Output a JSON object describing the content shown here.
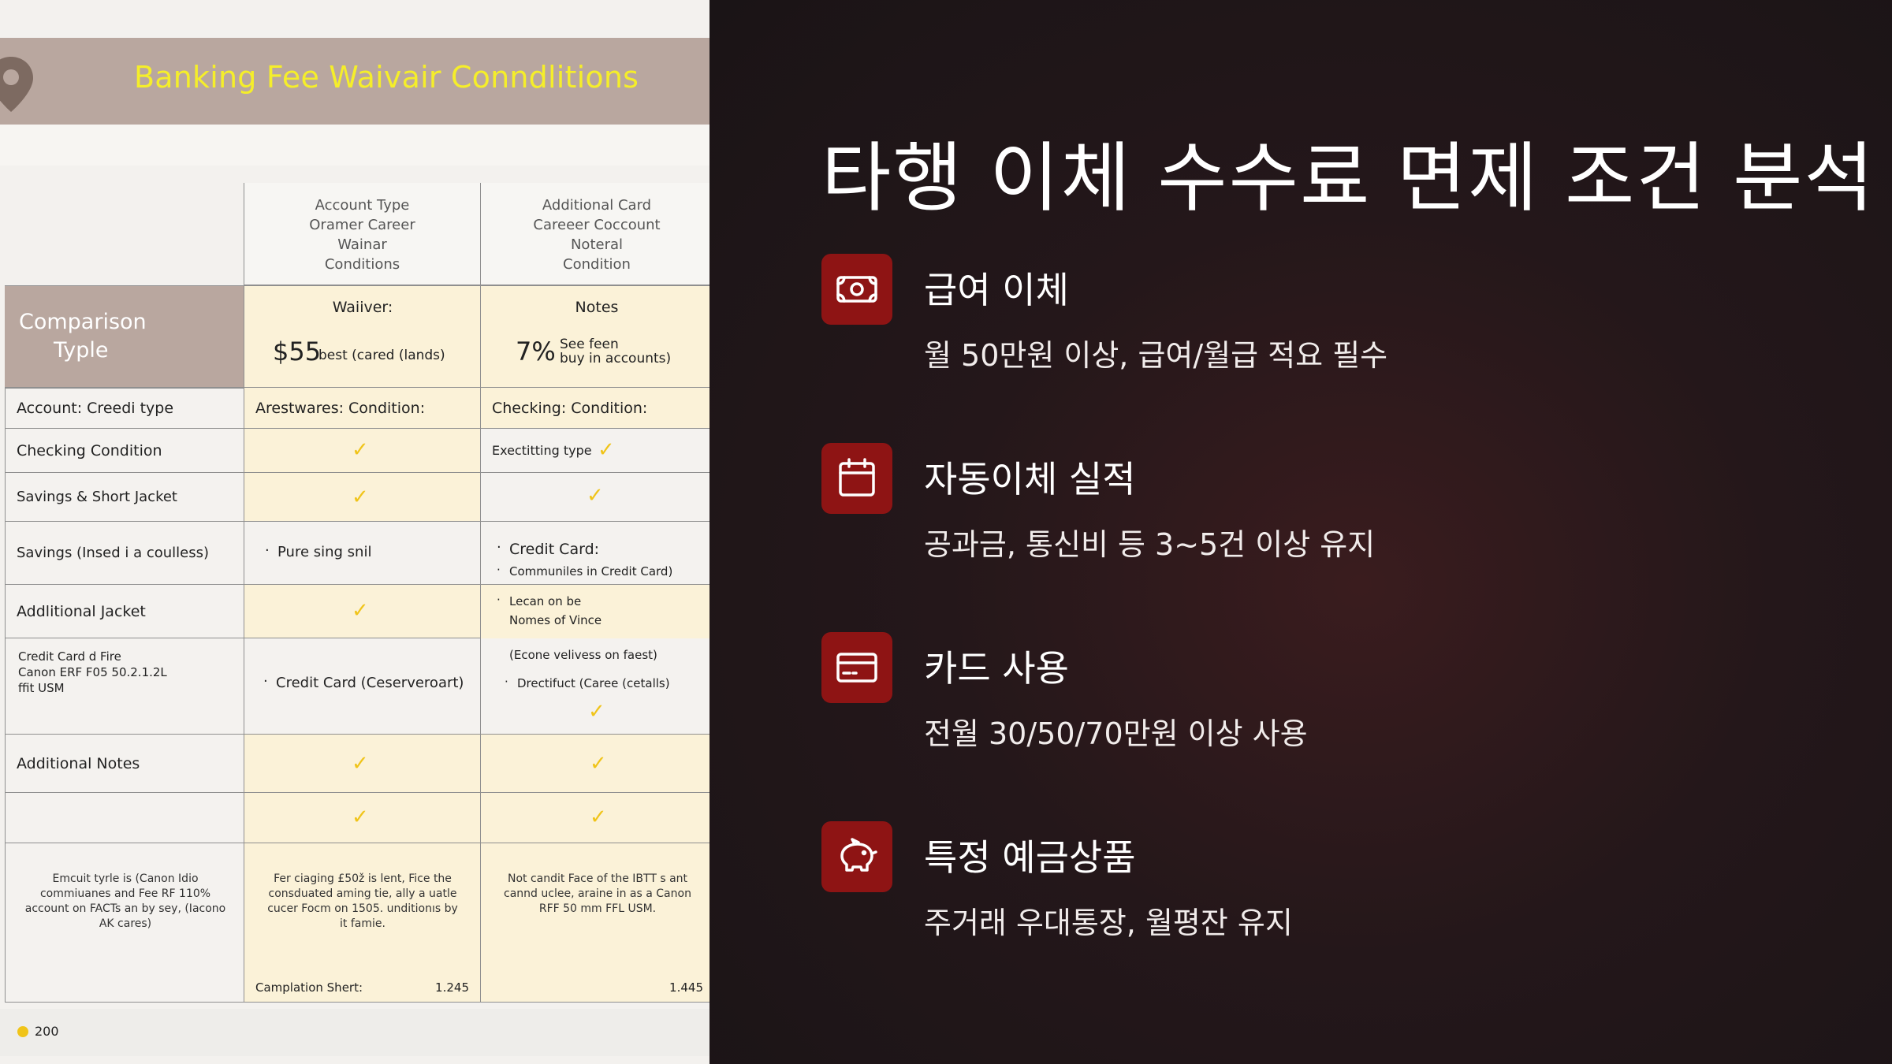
{
  "left_panel": {
    "banner_title": "Banking Fee Waivair Conndlitions",
    "headers": {
      "col1": [
        "Account Type",
        "Oramer Career",
        "Wainar",
        "Conditions"
      ],
      "col2": [
        "Additional Card",
        "Careeer Coccount",
        "Noteral",
        "Condition"
      ]
    },
    "comparison": {
      "label_line1": "Comparison",
      "label_line2": "Typle",
      "col1_title": "Waiiver:",
      "col1_amount": "$55",
      "col1_note": "best (cared (lands)",
      "col2_title": "Notes",
      "col2_amount": "7%",
      "col2_note_1": "See feen",
      "col2_note_2": "buy in accounts)"
    },
    "rows": {
      "r1_label": "Account:  Creedi type",
      "r1_col1": "Arestwares: Condition:",
      "r1_col2": "Checking: Condition:",
      "r2_label": "Checking Condition",
      "r2_col2": "Exectitting type",
      "r3_label": "Savings & Short  Jacket",
      "r4_label": "Savings (Insed i a coulless)",
      "r4_col1": "Pure sing snil",
      "r4_col2_a": "Credit Card:",
      "r4_col2_b": "Communiles in Credit Card)",
      "r5_label": "Addlitional Jacket",
      "r5_col2_a": "Lecan on be",
      "r5_col2_b": "Nomes of Vince",
      "r6_label_a": "Credit Card d Fire",
      "r6_label_b": "Canon ERF F05 50.2.1.2L",
      "r6_label_c": "ffit USM",
      "r6_col1": "Credit Card (Ceserveroart)",
      "r6_col2_a": "(Econe velivess on faest)",
      "r6_col2_b": "Drectifuct (Caree (cetalls)",
      "r7_label": "Additional Notes",
      "r9_label": "Emcuit tyrle is (Canon Idio commiuanes and Fee RF 110% account on FACTs an by sey, (Iacono AK cares)",
      "r9_col1": "Fer ciaging £50ž is lent, Fice the consduated aming tie, ally a uatle cucer Focm on 1505. unditionıs by it famie.",
      "r9_col2": "Not candit Face of the IBTT s ant cannd uclee, araine in as a Canon RFF 50 mm FFL USM.",
      "r9_col1_foot_label": "Camplation Shert:",
      "r9_col1_foot_val": "1.245",
      "r9_col2_foot_val": "1.445"
    },
    "footer_num": "200"
  },
  "right_panel": {
    "title": "타행 이체 수수료 면제 조건 분석",
    "features": [
      {
        "icon": "money-icon",
        "title": "급여 이체",
        "desc": "월 50만원 이상, 급여/월급 적요 필수"
      },
      {
        "icon": "calendar-icon",
        "title": "자동이체 실적",
        "desc": "공과금, 통신비 등 3~5건 이상 유지"
      },
      {
        "icon": "credit-card-icon",
        "title": "카드 사용",
        "desc": "전월 30/50/70만원 이상 사용"
      },
      {
        "icon": "piggy-bank-icon",
        "title": "특정 예금상품",
        "desc": "주거래 우대통장, 월평잔 유지"
      }
    ]
  },
  "colors": {
    "banner_bg": "#b9a79f",
    "banner_text": "#f5ee2a",
    "check": "#f0c419",
    "icon_box": "#8e1414",
    "right_bg": "#1a1416"
  }
}
